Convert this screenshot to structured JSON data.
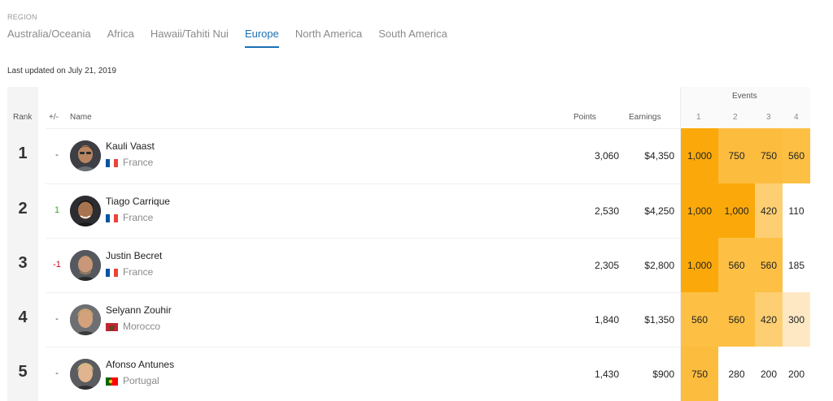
{
  "region": {
    "label": "REGION",
    "tabs": [
      "Australia/Oceania",
      "Africa",
      "Hawaii/Tahiti Nui",
      "Europe",
      "North America",
      "South America"
    ],
    "active_tab": "Europe"
  },
  "last_updated": "Last updated on July 21, 2019",
  "table": {
    "headers": {
      "rank": "Rank",
      "move": "+/-",
      "name": "Name",
      "points": "Points",
      "earnings": "Earnings",
      "events": "Events",
      "event_numbers": [
        "1",
        "2",
        "3",
        "4"
      ]
    },
    "rows": [
      {
        "rank": "1",
        "move": "-",
        "name": "Kauli Vaast",
        "country": "France",
        "flag": "flag-france",
        "points": "3,060",
        "earnings": "$4,350",
        "events": [
          "1,000",
          "750",
          "750",
          "560"
        ],
        "event_colors": [
          "#fba90a",
          "#fcbc3e",
          "#fcbc3e",
          "#fdc045"
        ]
      },
      {
        "rank": "2",
        "move": "1",
        "name": "Tiago Carrique",
        "country": "France",
        "flag": "flag-france",
        "points": "2,530",
        "earnings": "$4,250",
        "events": [
          "1,000",
          "1,000",
          "420",
          "110"
        ],
        "event_colors": [
          "#fba90a",
          "#fba90a",
          "#fdcf72",
          "#ffffff"
        ]
      },
      {
        "rank": "3",
        "move": "-1",
        "name": "Justin Becret",
        "country": "France",
        "flag": "flag-france",
        "points": "2,305",
        "earnings": "$2,800",
        "events": [
          "1,000",
          "560",
          "560",
          "185"
        ],
        "event_colors": [
          "#fba90a",
          "#fdc045",
          "#fdc045",
          "#ffffff"
        ]
      },
      {
        "rank": "4",
        "move": "-",
        "name": "Selyann Zouhir",
        "country": "Morocco",
        "flag": "flag-morocco",
        "points": "1,840",
        "earnings": "$1,350",
        "events": [
          "560",
          "560",
          "420",
          "300"
        ],
        "event_colors": [
          "#fdc045",
          "#fdc045",
          "#fdcf72",
          "#fee8c4"
        ]
      },
      {
        "rank": "5",
        "move": "-",
        "name": "Afonso Antunes",
        "country": "Portugal",
        "flag": "flag-portugal",
        "points": "1,430",
        "earnings": "$900",
        "events": [
          "750",
          "280",
          "200",
          "200"
        ],
        "event_colors": [
          "#fcbc3e",
          "#ffffff",
          "#ffffff",
          "#ffffff"
        ]
      }
    ]
  }
}
